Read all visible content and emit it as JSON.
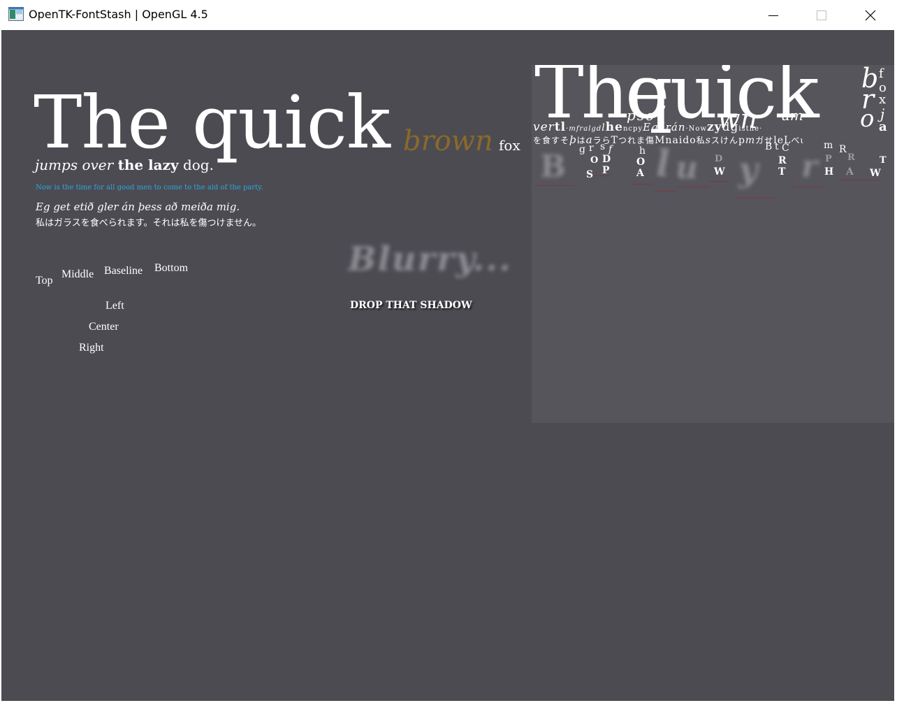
{
  "window": {
    "title": "OpenTK-FontStash | OpenGL 4.5",
    "icon": "app-window-icon",
    "controls": {
      "minimize": "minimize-icon",
      "maximize": "maximize-icon",
      "close": "close-icon"
    }
  },
  "colors": {
    "background": "#4c4b52",
    "text": "#ffffff",
    "brown": "#8a6a2a",
    "blue_text": "#2aa8e0",
    "atlas_bg": "#55555b"
  },
  "demo": {
    "the_quick": "The quick",
    "brown": "brown",
    "fox": "fox",
    "jumps_over": "jumps over",
    "the_lazy": "the lazy",
    "dog": "dog.",
    "now_is_the_time": "Now is the time for all good men to come to the aid of the party.",
    "icelandic": "Eg get etið gler án þess að meiða mig.",
    "japanese": "私はガラスを食べられます。それは私を傷つけません。",
    "blurry": "Blurry...",
    "drop_shadow": "DROP THAT SHADOW",
    "align_vertical": [
      "Top",
      "Middle",
      "Baseline",
      "Bottom"
    ],
    "align_horizontal": [
      "Left",
      "Center",
      "Right"
    ]
  },
  "atlas": {
    "big_row": [
      "The",
      "quick"
    ],
    "row1": [
      "b",
      "f",
      "o",
      "x",
      "r",
      "j",
      "o",
      "a"
    ],
    "row2": [
      "v",
      "e",
      "r",
      "t",
      "l",
      "·",
      "m",
      "f",
      "r",
      "a",
      "l",
      "g",
      "d",
      "l",
      "h",
      "e",
      "n",
      "c",
      "p",
      "y",
      "E",
      "g",
      "ð",
      "r",
      "á",
      "n",
      "·",
      "N",
      "o",
      "w",
      "z",
      "y",
      "d",
      "g",
      "i",
      "s",
      "t",
      "h",
      "e",
      "·"
    ],
    "row3": [
      "を",
      "食",
      "す",
      "そ",
      "þ",
      "は",
      "a",
      "ラ",
      "ら",
      "T",
      "つ",
      "れ",
      "ま",
      "傷",
      "M",
      "n",
      "a",
      "i",
      "d",
      "o",
      "私",
      "s",
      "ス",
      "け",
      "ん",
      "p",
      "m",
      "ガ",
      "せ",
      "l",
      "e",
      "L",
      "べ",
      "ι"
    ],
    "mid_row": [
      "p",
      "s",
      "o",
      "w",
      "n",
      "u",
      "m"
    ],
    "row4": [
      "g",
      "r",
      "s",
      "f",
      "h",
      "B",
      "t",
      "C",
      "m",
      "R"
    ],
    "bold_row": [
      "S",
      "O",
      "D",
      "P",
      "O",
      "A",
      "D",
      "W",
      "R",
      "T",
      "P",
      "H",
      "R",
      "A",
      "W",
      "T"
    ],
    "blur_row": [
      "B",
      "l",
      "u",
      "y",
      "r"
    ]
  }
}
